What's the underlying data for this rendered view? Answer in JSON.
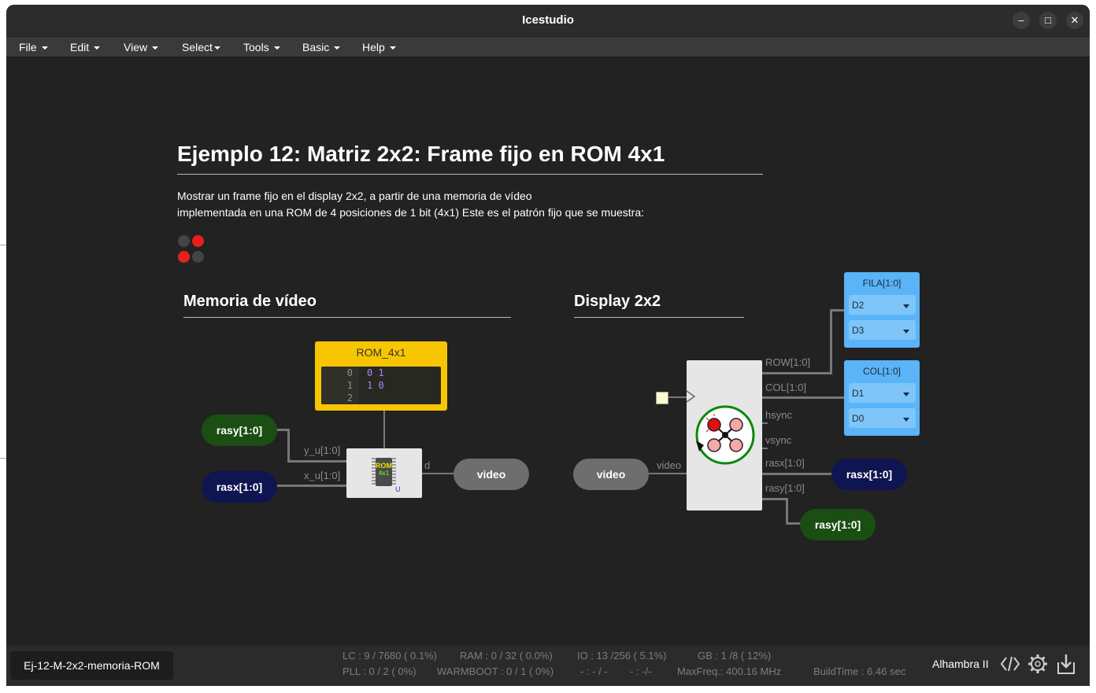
{
  "window": {
    "title": "Icestudio"
  },
  "menu": [
    {
      "label": "File"
    },
    {
      "label": "Edit"
    },
    {
      "label": "View"
    },
    {
      "label": "Select"
    },
    {
      "label": "Tools"
    },
    {
      "label": "Basic"
    },
    {
      "label": "Help"
    }
  ],
  "doc": {
    "heading": "Ejemplo 12: Matriz 2x2: Frame fijo en ROM 4x1",
    "desc_line1": "Mostrar un frame fijo en el display 2x2, a partir de una memoria de vídeo",
    "desc_line2": "implementada en una ROM de 4 posiciones de 1 bit (4x1) Este es el patrón fijo que se muestra:",
    "pattern": [
      [
        "off",
        "on"
      ],
      [
        "on",
        "off"
      ]
    ],
    "pattern_colors": {
      "on": "#e8201c",
      "off": "#444444"
    },
    "section_left": "Memoria de vídeo",
    "section_right": "Display 2x2"
  },
  "circuit": {
    "rom": {
      "title": "ROM_4x1",
      "line_numbers": [
        "0",
        "1",
        "2"
      ],
      "lines": [
        "0 1",
        "1 0",
        ""
      ]
    },
    "rom_icon_text": "ROM",
    "rom_icon_sub": "4x1",
    "rom_icon_u": "U",
    "labels": {
      "y_u": "y_u[1:0]",
      "x_u": "x_u[1:0]",
      "d": "d",
      "video_in": "video",
      "row": "ROW[1:0]",
      "col": "COL[1:0]",
      "hsync": "hsync",
      "vsync": "vsync",
      "rasx": "rasx[1:0]",
      "rasy": "rasy[1:0]"
    },
    "pills": {
      "rasy_left": "rasy[1:0]",
      "rasx_left": "rasx[1:0]",
      "video_out": "video",
      "video_in": "video",
      "rasx_right": "rasx[1:0]",
      "rasy_right": "rasy[1:0]"
    },
    "colors": {
      "green": "#1a4e12",
      "navy": "#0f1550",
      "gray": "#6e6e6e",
      "rom": "#f7c600",
      "panel": "#5ab4f7"
    },
    "fila": {
      "title": "FILA[1:0]",
      "pins": [
        "D2",
        "D3"
      ]
    },
    "col": {
      "title": "COL[1:0]",
      "pins": [
        "D1",
        "D0"
      ]
    }
  },
  "footer": {
    "project": "Ej-12-M-2x2-memoria-ROM",
    "stats_row1": [
      "LC : 9 / 7680 ( 0.1%)",
      "RAM : 0 / 32 ( 0.0%)",
      "IO :  13 /256  ( 5.1%)",
      "GB :  1 /8  ( 12%)"
    ],
    "stats_row2": [
      "PLL : 0 / 2 ( 0%)",
      "WARMBOOT : 0 / 1 ( 0%)",
      "- : - / -",
      "- : -/-",
      "MaxFreq.:  400.16 MHz",
      "BuildTime :   6.46 sec"
    ],
    "board": "Alhambra II"
  }
}
